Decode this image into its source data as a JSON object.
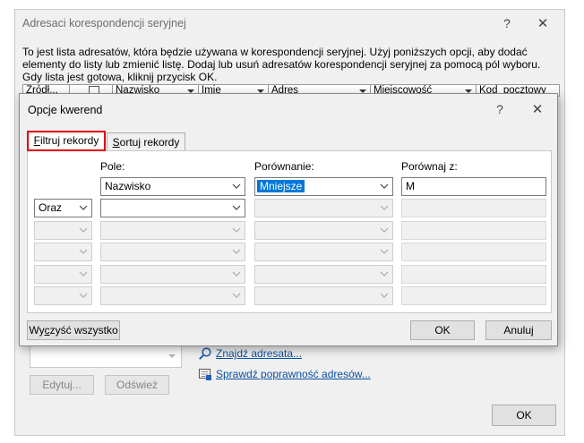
{
  "outer": {
    "title": "Adresaci korespondencji seryjnej",
    "help": "?",
    "close": "✕",
    "description": "To jest lista adresatów, która będzie używana w korespondencji seryjnej. Użyj poniższych opcji, aby dodać elementy do listy lub zmienić listę. Dodaj lub usuń adresatów korespondencji seryjnej za pomocą pól wyboru. Gdy lista jest gotowa, kliknij przycisk OK.",
    "columns": [
      "Źródł...",
      "",
      "Nazwisko",
      "Imię",
      "Adres",
      "Miejscowość",
      "Kod_pocztowy"
    ],
    "edit_button": "Edytuj...",
    "refresh_button": "Odśwież",
    "link_find": "Znajdź adresata...",
    "link_verify": "Sprawdź poprawność adresów...",
    "ok_button": "OK"
  },
  "dialog": {
    "title": "Opcje kwerend",
    "help": "?",
    "close": "✕",
    "tabs": {
      "filter": {
        "prefix": "",
        "accel": "F",
        "rest": "iltruj rekordy"
      },
      "sort": {
        "prefix": "",
        "accel": "S",
        "rest": "ortuj rekordy"
      }
    },
    "headers": {
      "field": "Pole:",
      "comparison": "Porównanie:",
      "compare_to": "Porównaj z:"
    },
    "rows": [
      {
        "conj": "",
        "field": "Nazwisko",
        "comparison": "Mniejsze",
        "value": "M"
      },
      {
        "conj": "Oraz",
        "field": "",
        "comparison": "",
        "value": ""
      },
      {
        "conj": "",
        "field": "",
        "comparison": "",
        "value": ""
      },
      {
        "conj": "",
        "field": "",
        "comparison": "",
        "value": ""
      },
      {
        "conj": "",
        "field": "",
        "comparison": "",
        "value": ""
      },
      {
        "conj": "",
        "field": "",
        "comparison": "",
        "value": ""
      }
    ],
    "clear_button": {
      "prefix": "Wy",
      "accel": "c",
      "rest": "zyść wszystko"
    },
    "ok_button": "OK",
    "cancel_button": "Anuluj"
  },
  "colors": {
    "highlight_border": "#e00000",
    "selection": "#0078d7",
    "link": "#0b4ea2"
  }
}
